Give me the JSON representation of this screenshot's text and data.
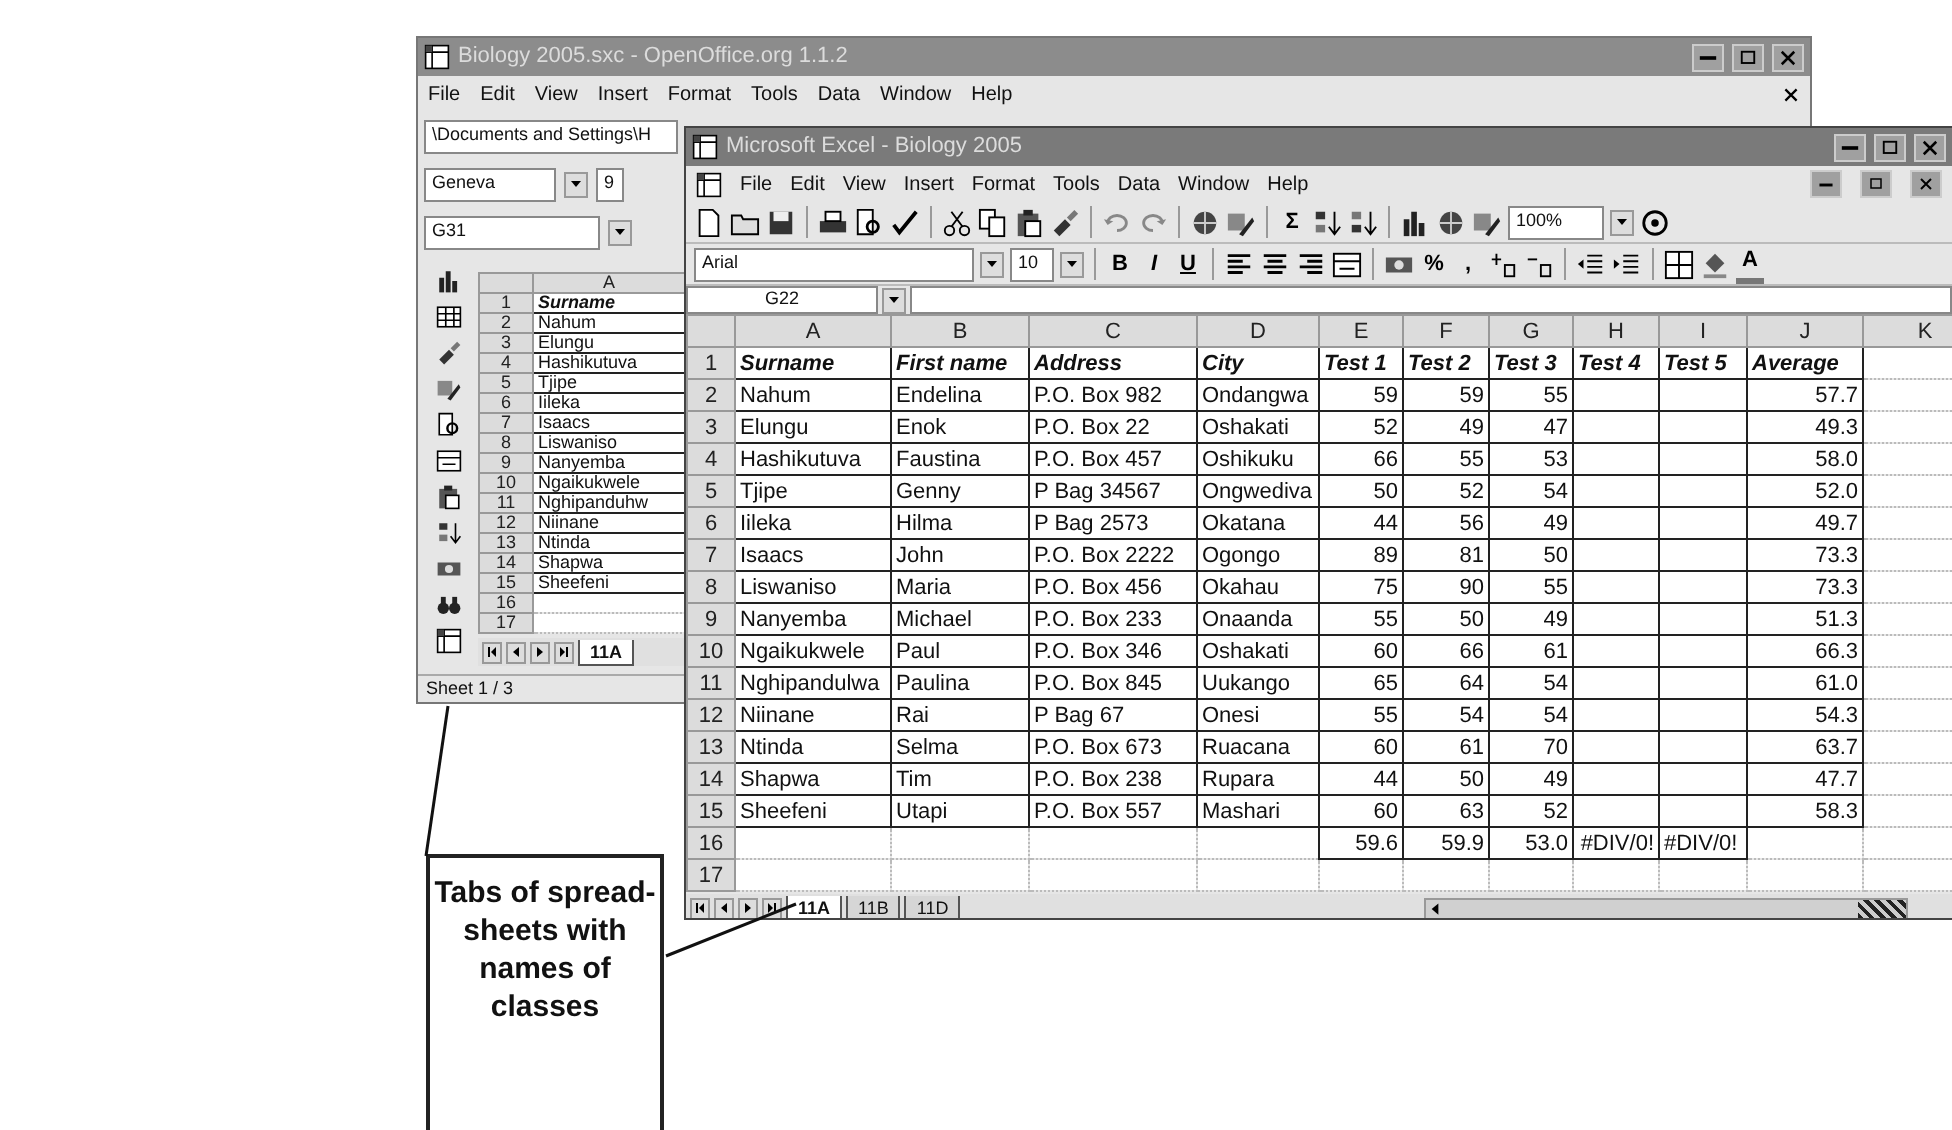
{
  "back_window": {
    "title": "Biology 2005.sxc - OpenOffice.org 1.1.2",
    "menu": [
      "File",
      "Edit",
      "View",
      "Insert",
      "Format",
      "Tools",
      "Data",
      "Window",
      "Help"
    ],
    "path": "\\Documents and Settings\\H",
    "font_name": "Geneva",
    "font_size": "9",
    "name_box": "G31",
    "column_header": "A",
    "rows": [
      {
        "number": "1",
        "kind": "header",
        "value": "Surname"
      },
      {
        "number": "2",
        "kind": "data",
        "value": "Nahum"
      },
      {
        "number": "3",
        "kind": "data",
        "value": "Elungu"
      },
      {
        "number": "4",
        "kind": "data",
        "value": "Hashikutuva"
      },
      {
        "number": "5",
        "kind": "data",
        "value": "Tjipe"
      },
      {
        "number": "6",
        "kind": "data",
        "value": "Iileka"
      },
      {
        "number": "7",
        "kind": "data",
        "value": "Isaacs"
      },
      {
        "number": "8",
        "kind": "data",
        "value": "Liswaniso"
      },
      {
        "number": "9",
        "kind": "data",
        "value": "Nanyemba"
      },
      {
        "number": "10",
        "kind": "data",
        "value": "Ngaikukwele"
      },
      {
        "number": "11",
        "kind": "data",
        "value": "Nghipanduhw"
      },
      {
        "number": "12",
        "kind": "data",
        "value": "Niinane"
      },
      {
        "number": "13",
        "kind": "data",
        "value": "Ntinda"
      },
      {
        "number": "14",
        "kind": "data",
        "value": "Shapwa"
      },
      {
        "number": "15",
        "kind": "data",
        "value": "Sheefeni"
      },
      {
        "number": "16",
        "kind": "blank"
      },
      {
        "number": "17",
        "kind": "blank"
      }
    ],
    "sheet_tabs": [
      {
        "label": "11A",
        "selected": true
      }
    ],
    "status": "Sheet 1 / 3"
  },
  "front_window": {
    "title": "Microsoft Excel - Biology 2005",
    "menu": [
      "File",
      "Edit",
      "View",
      "Insert",
      "Format",
      "Tools",
      "Data",
      "Window",
      "Help"
    ],
    "zoom": "100%",
    "sum_label": "Σ",
    "font_name": "Arial",
    "font_size": "10",
    "format_buttons": [
      "B",
      "I",
      "U"
    ],
    "number_buttons": [
      "%",
      ","
    ],
    "font_color_label": "A",
    "name_box": "G22",
    "columns": [
      {
        "label": "A",
        "kind": "text"
      },
      {
        "label": "B",
        "kind": "text"
      },
      {
        "label": "C",
        "kind": "text"
      },
      {
        "label": "D",
        "kind": "text"
      },
      {
        "label": "E",
        "kind": "number"
      },
      {
        "label": "F",
        "kind": "number"
      },
      {
        "label": "G",
        "kind": "number"
      },
      {
        "label": "H",
        "kind": "number"
      },
      {
        "label": "I",
        "kind": "text"
      },
      {
        "label": "J",
        "kind": "number"
      },
      {
        "label": "K",
        "kind": "text"
      }
    ],
    "rows": [
      {
        "number": "1",
        "kind": "header",
        "cells": {
          "A": "Surname",
          "B": "First name",
          "C": "Address",
          "D": "City",
          "E": "Test 1",
          "F": "Test 2",
          "G": "Test 3",
          "H": "Test 4",
          "I": "Test 5",
          "J": "Average"
        }
      },
      {
        "number": "2",
        "kind": "data",
        "cells": {
          "A": "Nahum",
          "B": "Endelina",
          "C": "P.O. Box 982",
          "D": "Ondangwa",
          "E": "59",
          "F": "59",
          "G": "55",
          "J": "57.7"
        }
      },
      {
        "number": "3",
        "kind": "data",
        "cells": {
          "A": "Elungu",
          "B": "Enok",
          "C": "P.O. Box 22",
          "D": "Oshakati",
          "E": "52",
          "F": "49",
          "G": "47",
          "J": "49.3"
        }
      },
      {
        "number": "4",
        "kind": "data",
        "cells": {
          "A": "Hashikutuva",
          "B": "Faustina",
          "C": "P.O. Box 457",
          "D": "Oshikuku",
          "E": "66",
          "F": "55",
          "G": "53",
          "J": "58.0"
        }
      },
      {
        "number": "5",
        "kind": "data",
        "cells": {
          "A": "Tjipe",
          "B": "Genny",
          "C": "P Bag 34567",
          "D": "Ongwediva",
          "E": "50",
          "F": "52",
          "G": "54",
          "J": "52.0"
        }
      },
      {
        "number": "6",
        "kind": "data",
        "cells": {
          "A": "Iileka",
          "B": "Hilma",
          "C": "P Bag 2573",
          "D": "Okatana",
          "E": "44",
          "F": "56",
          "G": "49",
          "J": "49.7"
        }
      },
      {
        "number": "7",
        "kind": "data",
        "cells": {
          "A": "Isaacs",
          "B": "John",
          "C": "P.O. Box 2222",
          "D": "Ogongo",
          "E": "89",
          "F": "81",
          "G": "50",
          "J": "73.3"
        }
      },
      {
        "number": "8",
        "kind": "data",
        "cells": {
          "A": "Liswaniso",
          "B": "Maria",
          "C": "P.O. Box 456",
          "D": "Okahau",
          "E": "75",
          "F": "90",
          "G": "55",
          "J": "73.3"
        }
      },
      {
        "number": "9",
        "kind": "data",
        "cells": {
          "A": "Nanyemba",
          "B": "Michael",
          "C": "P.O. Box 233",
          "D": "Onaanda",
          "E": "55",
          "F": "50",
          "G": "49",
          "J": "51.3"
        }
      },
      {
        "number": "10",
        "kind": "data",
        "cells": {
          "A": "Ngaikukwele",
          "B": "Paul",
          "C": "P.O. Box 346",
          "D": "Oshakati",
          "E": "60",
          "F": "66",
          "G": "61",
          "J": "66.3"
        }
      },
      {
        "number": "11",
        "kind": "data",
        "cells": {
          "A": "Nghipandulwa",
          "B": "Paulina",
          "C": "P.O. Box 845",
          "D": "Uukango",
          "E": "65",
          "F": "64",
          "G": "54",
          "J": "61.0"
        }
      },
      {
        "number": "12",
        "kind": "data",
        "cells": {
          "A": "Niinane",
          "B": "Rai",
          "C": "P Bag 67",
          "D": "Onesi",
          "E": "55",
          "F": "54",
          "G": "54",
          "J": "54.3"
        }
      },
      {
        "number": "13",
        "kind": "data",
        "cells": {
          "A": "Ntinda",
          "B": "Selma",
          "C": "P.O. Box 673",
          "D": "Ruacana",
          "E": "60",
          "F": "61",
          "G": "70",
          "J": "63.7"
        }
      },
      {
        "number": "14",
        "kind": "data",
        "cells": {
          "A": "Shapwa",
          "B": "Tim",
          "C": "P.O. Box 238",
          "D": "Rupara",
          "E": "44",
          "F": "50",
          "G": "49",
          "J": "47.7"
        }
      },
      {
        "number": "15",
        "kind": "data",
        "cells": {
          "A": "Sheefeni",
          "B": "Utapi",
          "C": "P.O. Box 557",
          "D": "Mashari",
          "E": "60",
          "F": "63",
          "G": "52",
          "J": "58.3"
        }
      },
      {
        "number": "16",
        "kind": "totals",
        "cells": {
          "E": "59.6",
          "F": "59.9",
          "G": "53.0",
          "H": "#DIV/0!",
          "I": "#DIV/0!"
        }
      },
      {
        "number": "17",
        "kind": "blank",
        "cells": {}
      }
    ],
    "sheet_tabs": [
      {
        "label": "11A",
        "selected": true
      },
      {
        "label": "11B",
        "selected": false
      },
      {
        "label": "11D",
        "selected": false
      }
    ]
  },
  "callout": {
    "text": "Tabs of spread-sheets with names of classes"
  }
}
